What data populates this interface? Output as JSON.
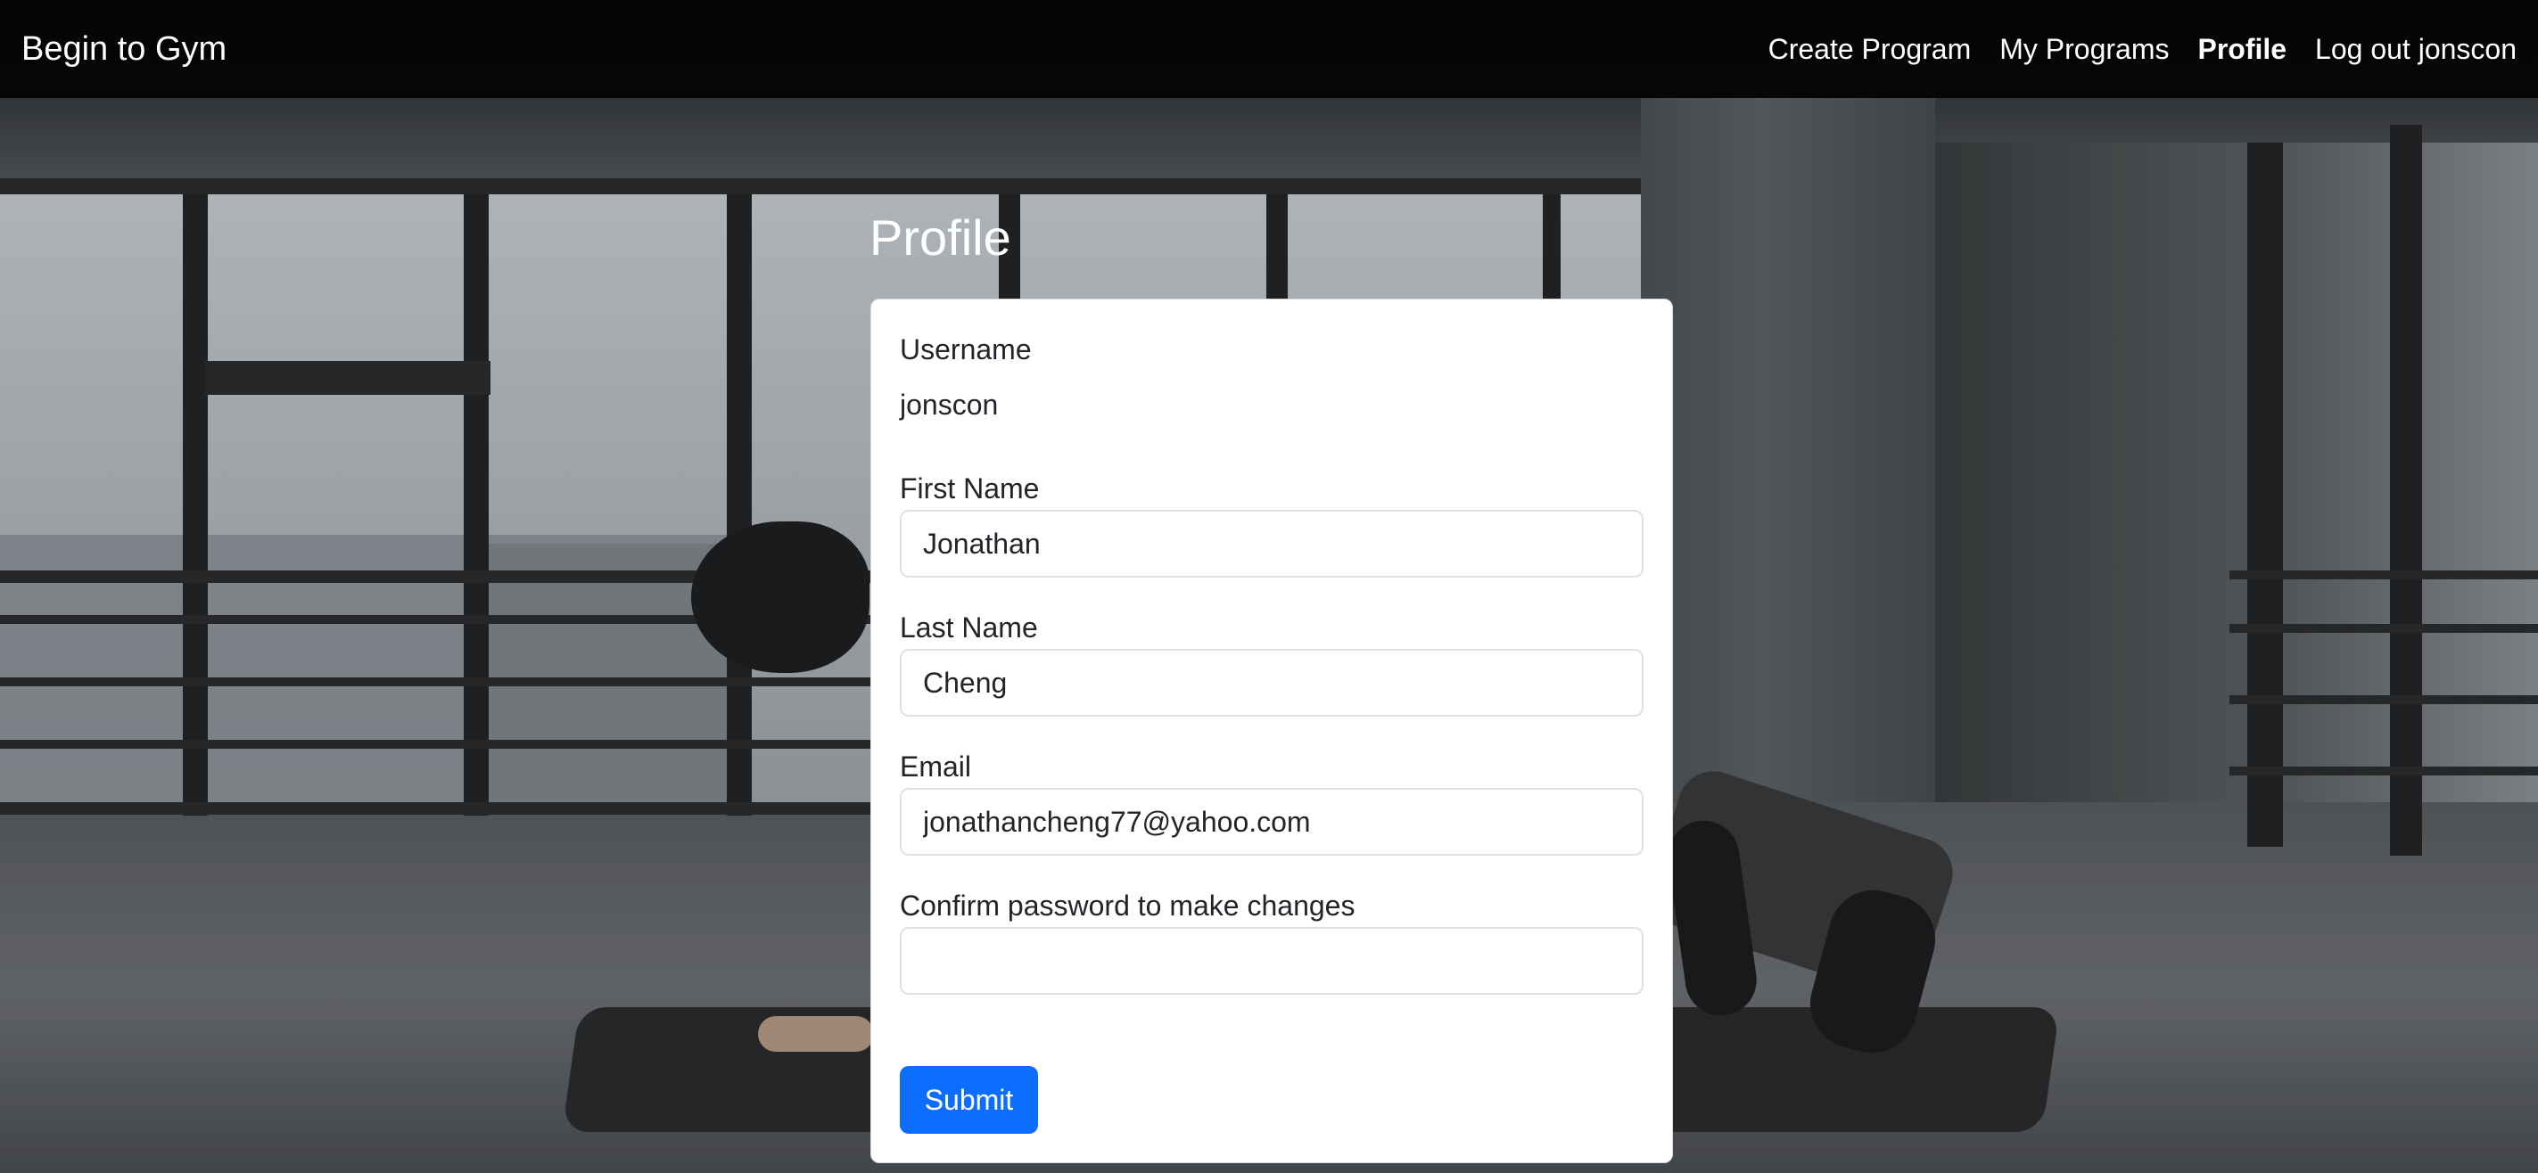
{
  "navbar": {
    "brand": "Begin to Gym",
    "links": [
      {
        "label": "Create Program",
        "active": false
      },
      {
        "label": "My Programs",
        "active": false
      },
      {
        "label": "Profile",
        "active": true
      },
      {
        "label": "Log out jonscon",
        "active": false
      }
    ]
  },
  "page": {
    "title": "Profile"
  },
  "form": {
    "username_label": "Username",
    "username_value": "jonscon",
    "first_name_label": "First Name",
    "first_name_value": "Jonathan",
    "last_name_label": "Last Name",
    "last_name_value": "Cheng",
    "email_label": "Email",
    "email_value": "jonathancheng77@yahoo.com",
    "password_label": "Confirm password to make changes",
    "password_value": "",
    "submit_label": "Submit"
  },
  "colors": {
    "accent": "#0d6efd",
    "navbar_bg": "#000000",
    "card_bg": "#ffffff"
  }
}
